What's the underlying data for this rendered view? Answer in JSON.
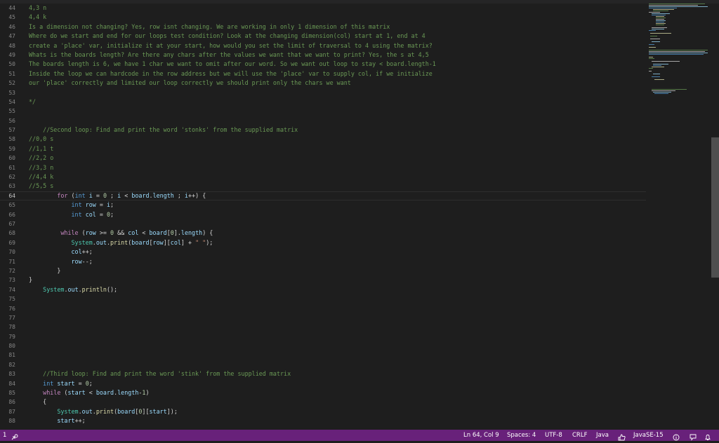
{
  "editor": {
    "lines": [
      {
        "n": "44",
        "tokens": [
          [
            "comment",
            "4,3 n"
          ]
        ]
      },
      {
        "n": "45",
        "tokens": [
          [
            "comment",
            "4,4 k"
          ]
        ]
      },
      {
        "n": "46",
        "tokens": [
          [
            "comment",
            "Is a dimension not changing? Yes, row isnt changing. We are working in only 1 dimension of this matrix"
          ]
        ]
      },
      {
        "n": "47",
        "tokens": [
          [
            "comment",
            "Where do we start and end for our loops test condition? Look at the changing dimension(col) start at 1, end at 4"
          ]
        ]
      },
      {
        "n": "48",
        "tokens": [
          [
            "comment",
            "create a 'place' var, initialize it at your start, how would you set the limit of traversal to 4 using the matrix?"
          ]
        ]
      },
      {
        "n": "49",
        "tokens": [
          [
            "comment",
            "Whats is the boards length? Are there any chars after the values we want that we want to print? Yes, the s at 4,5"
          ]
        ]
      },
      {
        "n": "50",
        "tokens": [
          [
            "comment",
            "The boards length is 6, we have 1 char we want to omit after our word. So we want out loop to stay < board.length-1"
          ]
        ]
      },
      {
        "n": "51",
        "tokens": [
          [
            "comment",
            "Inside the loop we can hardcode in the row address but we will use the 'place' var to supply col, if we initialize"
          ]
        ]
      },
      {
        "n": "52",
        "tokens": [
          [
            "comment",
            "our 'place' correctly and limited our loop correctly we should print only the chars we want"
          ]
        ]
      },
      {
        "n": "53",
        "tokens": []
      },
      {
        "n": "54",
        "tokens": [
          [
            "comment",
            "*/"
          ]
        ]
      },
      {
        "n": "55",
        "tokens": []
      },
      {
        "n": "56",
        "tokens": []
      },
      {
        "n": "57",
        "tokens": [
          [
            "plain",
            "    "
          ],
          [
            "comment",
            "//Second loop: Find and print the word 'stonks' from the supplied matrix"
          ]
        ]
      },
      {
        "n": "58",
        "tokens": [
          [
            "comment",
            "//0,0 s"
          ]
        ]
      },
      {
        "n": "59",
        "tokens": [
          [
            "comment",
            "//1,1 t"
          ]
        ]
      },
      {
        "n": "60",
        "tokens": [
          [
            "comment",
            "//2,2 o"
          ]
        ]
      },
      {
        "n": "61",
        "tokens": [
          [
            "comment",
            "//3,3 n"
          ]
        ]
      },
      {
        "n": "62",
        "tokens": [
          [
            "comment",
            "//4,4 k"
          ]
        ]
      },
      {
        "n": "63",
        "tokens": [
          [
            "comment",
            "//5,5 s"
          ]
        ]
      },
      {
        "n": "64",
        "current": true,
        "tokens": [
          [
            "plain",
            "        "
          ],
          [
            "control",
            "for"
          ],
          [
            "plain",
            " ("
          ],
          [
            "keyword",
            "int"
          ],
          [
            "plain",
            " "
          ],
          [
            "var",
            "i"
          ],
          [
            "plain",
            " = "
          ],
          [
            "number",
            "0"
          ],
          [
            "plain",
            " ; "
          ],
          [
            "var",
            "i"
          ],
          [
            "plain",
            " < "
          ],
          [
            "var",
            "board"
          ],
          [
            "plain",
            "."
          ],
          [
            "var",
            "length"
          ],
          [
            "plain",
            " ; "
          ],
          [
            "var",
            "i"
          ],
          [
            "plain",
            "++) {"
          ]
        ]
      },
      {
        "n": "65",
        "tokens": [
          [
            "plain",
            "            "
          ],
          [
            "keyword",
            "int"
          ],
          [
            "plain",
            " "
          ],
          [
            "var",
            "row"
          ],
          [
            "plain",
            " = "
          ],
          [
            "var",
            "i"
          ],
          [
            "plain",
            ";"
          ]
        ]
      },
      {
        "n": "66",
        "tokens": [
          [
            "plain",
            "            "
          ],
          [
            "keyword",
            "int"
          ],
          [
            "plain",
            " "
          ],
          [
            "var",
            "col"
          ],
          [
            "plain",
            " = "
          ],
          [
            "number",
            "0"
          ],
          [
            "plain",
            ";"
          ]
        ]
      },
      {
        "n": "67",
        "tokens": []
      },
      {
        "n": "68",
        "tokens": [
          [
            "plain",
            "         "
          ],
          [
            "control",
            "while"
          ],
          [
            "plain",
            " ("
          ],
          [
            "var",
            "row"
          ],
          [
            "plain",
            " >= "
          ],
          [
            "number",
            "0"
          ],
          [
            "plain",
            " && "
          ],
          [
            "var",
            "col"
          ],
          [
            "plain",
            " < "
          ],
          [
            "var",
            "board"
          ],
          [
            "plain",
            "["
          ],
          [
            "number",
            "0"
          ],
          [
            "plain",
            "]."
          ],
          [
            "var",
            "length"
          ],
          [
            "plain",
            ") {"
          ]
        ]
      },
      {
        "n": "69",
        "tokens": [
          [
            "plain",
            "            "
          ],
          [
            "type",
            "System"
          ],
          [
            "plain",
            "."
          ],
          [
            "var",
            "out"
          ],
          [
            "plain",
            "."
          ],
          [
            "func",
            "print"
          ],
          [
            "plain",
            "("
          ],
          [
            "var",
            "board"
          ],
          [
            "plain",
            "["
          ],
          [
            "var",
            "row"
          ],
          [
            "plain",
            "]["
          ],
          [
            "var",
            "col"
          ],
          [
            "plain",
            "] + "
          ],
          [
            "string",
            "\" \""
          ],
          [
            "plain",
            ");"
          ]
        ]
      },
      {
        "n": "70",
        "tokens": [
          [
            "plain",
            "            "
          ],
          [
            "var",
            "col"
          ],
          [
            "plain",
            "++;"
          ]
        ]
      },
      {
        "n": "71",
        "tokens": [
          [
            "plain",
            "            "
          ],
          [
            "var",
            "row"
          ],
          [
            "plain",
            "--;"
          ]
        ]
      },
      {
        "n": "72",
        "tokens": [
          [
            "plain",
            "        }"
          ]
        ]
      },
      {
        "n": "73",
        "tokens": [
          [
            "plain",
            "}"
          ]
        ]
      },
      {
        "n": "74",
        "tokens": [
          [
            "plain",
            "    "
          ],
          [
            "type",
            "System"
          ],
          [
            "plain",
            "."
          ],
          [
            "var",
            "out"
          ],
          [
            "plain",
            "."
          ],
          [
            "func",
            "println"
          ],
          [
            "plain",
            "();"
          ]
        ]
      },
      {
        "n": "75",
        "tokens": []
      },
      {
        "n": "76",
        "tokens": []
      },
      {
        "n": "77",
        "tokens": []
      },
      {
        "n": "78",
        "tokens": []
      },
      {
        "n": "79",
        "tokens": []
      },
      {
        "n": "80",
        "tokens": []
      },
      {
        "n": "81",
        "tokens": []
      },
      {
        "n": "82",
        "tokens": []
      },
      {
        "n": "83",
        "tokens": [
          [
            "plain",
            "    "
          ],
          [
            "comment",
            "//Third loop: Find and print the word 'stink' from the supplied matrix"
          ]
        ]
      },
      {
        "n": "84",
        "tokens": [
          [
            "plain",
            "    "
          ],
          [
            "keyword",
            "int"
          ],
          [
            "plain",
            " "
          ],
          [
            "var",
            "start"
          ],
          [
            "plain",
            " = "
          ],
          [
            "number",
            "0"
          ],
          [
            "plain",
            ";"
          ]
        ]
      },
      {
        "n": "85",
        "tokens": [
          [
            "plain",
            "    "
          ],
          [
            "control",
            "while"
          ],
          [
            "plain",
            " ("
          ],
          [
            "var",
            "start"
          ],
          [
            "plain",
            " < "
          ],
          [
            "var",
            "board"
          ],
          [
            "plain",
            "."
          ],
          [
            "var",
            "length"
          ],
          [
            "plain",
            "-"
          ],
          [
            "number",
            "1"
          ],
          [
            "plain",
            ")"
          ]
        ]
      },
      {
        "n": "86",
        "tokens": [
          [
            "plain",
            "    {"
          ]
        ]
      },
      {
        "n": "87",
        "tokens": [
          [
            "plain",
            "        "
          ],
          [
            "type",
            "System"
          ],
          [
            "plain",
            "."
          ],
          [
            "var",
            "out"
          ],
          [
            "plain",
            "."
          ],
          [
            "func",
            "print"
          ],
          [
            "plain",
            "("
          ],
          [
            "var",
            "board"
          ],
          [
            "plain",
            "["
          ],
          [
            "number",
            "0"
          ],
          [
            "plain",
            "]["
          ],
          [
            "var",
            "start"
          ],
          [
            "plain",
            "]);"
          ]
        ]
      },
      {
        "n": "88",
        "tokens": [
          [
            "plain",
            "        "
          ],
          [
            "var",
            "start"
          ],
          [
            "plain",
            "++;"
          ]
        ]
      }
    ]
  },
  "colors": {
    "comment": "#6a9955",
    "keyword": "#569cd6",
    "control": "#c586c0",
    "var": "#9cdcfe",
    "number": "#b5cea8",
    "string": "#ce9178",
    "func": "#dcdcaa",
    "type": "#4ec9b0",
    "plain": "#d4d4d4",
    "status_bar": "#68217a",
    "editor_bg": "#1e1e1e"
  },
  "statusbar": {
    "left_number": "1",
    "left_icon": "live-share-icon",
    "position": "Ln 64, Col 9",
    "spaces": "Spaces: 4",
    "encoding": "UTF-8",
    "eol": "CRLF",
    "language": "Java",
    "thumbs_icon": "thumbs-up-icon",
    "java_version": "JavaSE-15",
    "info_icon": "info-icon",
    "feedback_icon": "feedback-icon",
    "bell_icon": "bell-icon"
  }
}
